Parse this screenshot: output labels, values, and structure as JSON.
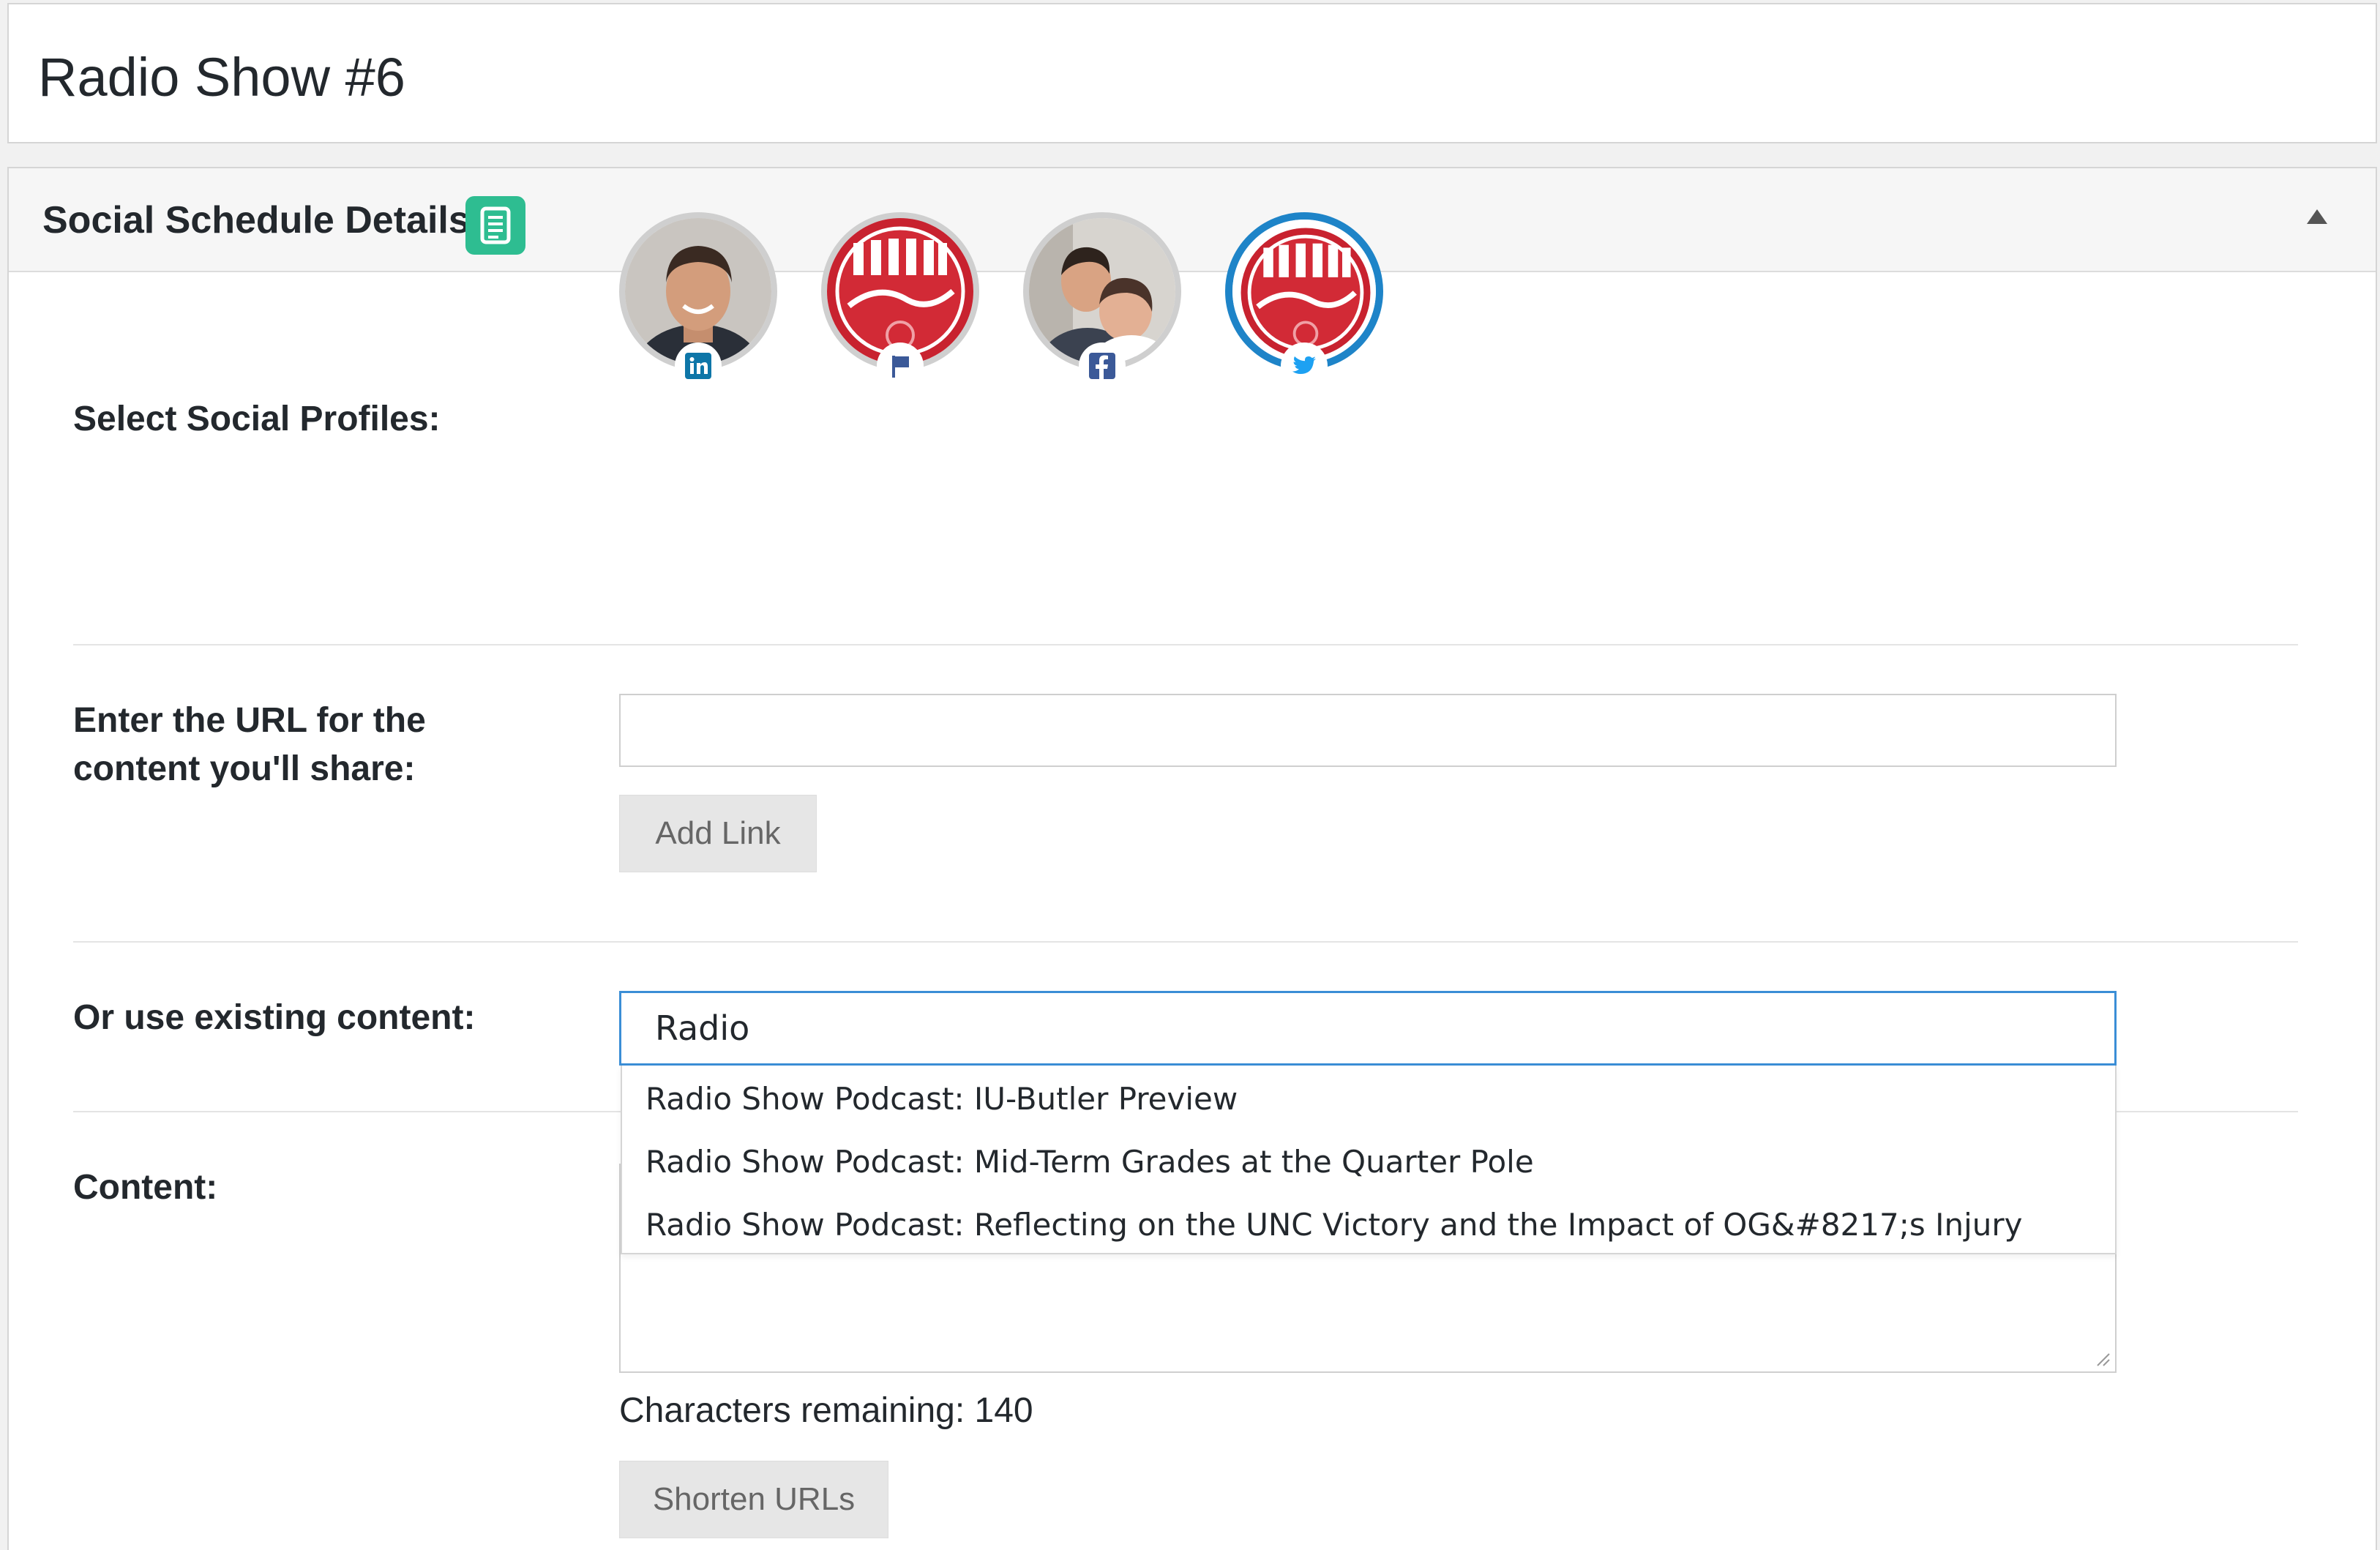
{
  "post": {
    "title": "Radio Show #6"
  },
  "panel": {
    "title": "Social Schedule Details",
    "icon": "document-list-icon",
    "collapse_icon": "triangle-up-icon",
    "accent_color": "#2ebd91"
  },
  "profiles": {
    "label": "Select Social Profiles:",
    "items": [
      {
        "network": "linkedin",
        "badge_icon": "linkedin-icon",
        "selected": false
      },
      {
        "network": "page",
        "badge_icon": "flag-icon",
        "selected": false
      },
      {
        "network": "facebook",
        "badge_icon": "facebook-icon",
        "selected": false
      },
      {
        "network": "twitter",
        "badge_icon": "twitter-icon",
        "selected": true
      }
    ],
    "selected_color": "#1e84c8"
  },
  "url_field": {
    "label_line1": "Enter the URL for the",
    "label_line2": "content you'll share:",
    "value": "",
    "button": "Add Link"
  },
  "existing": {
    "label": "Or use existing content:",
    "value": "Radio",
    "suggestions": [
      "Radio Show Podcast: IU-Butler Preview",
      "Radio Show Podcast: Mid-Term Grades at the Quarter Pole",
      "Radio Show Podcast: Reflecting on the UNC Victory and the Impact of OG&#8217;s Injury"
    ]
  },
  "content": {
    "label": "Content:",
    "chars_remaining": "Characters remaining: 140",
    "shorten_button": "Shorten URLs"
  }
}
